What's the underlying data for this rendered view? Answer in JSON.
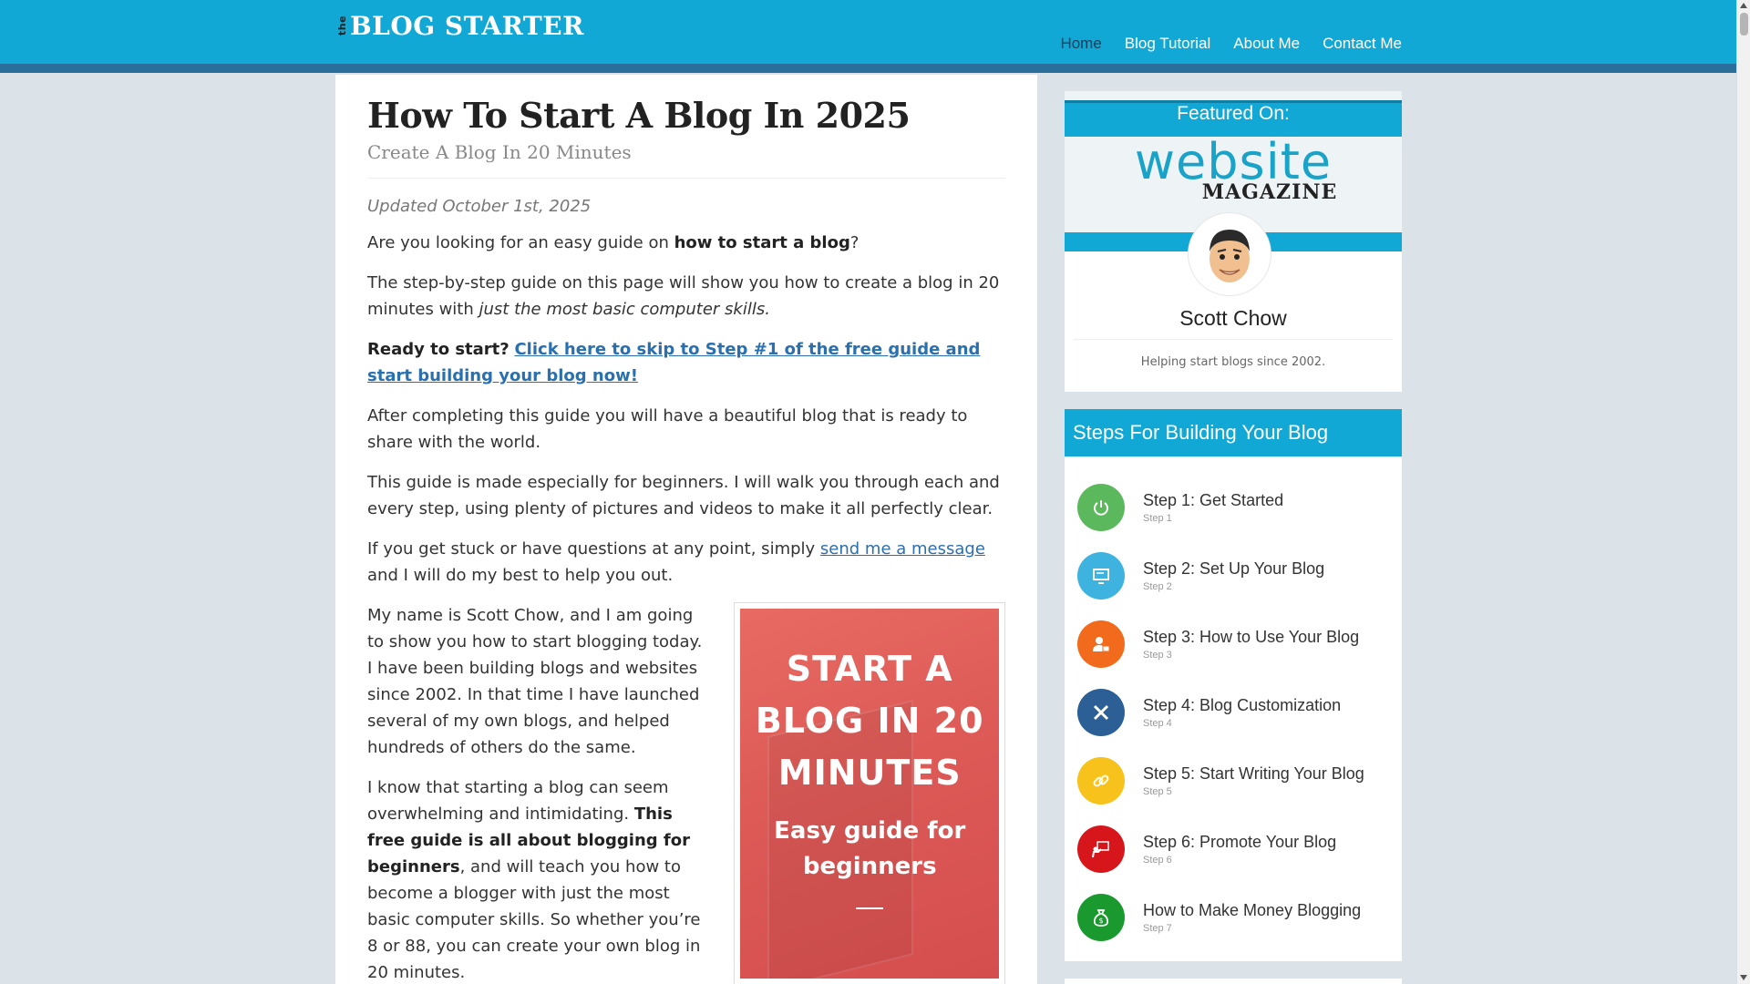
{
  "header": {
    "logo_the": "the",
    "logo_text": "BLOG STARTER",
    "nav": [
      {
        "label": "Home"
      },
      {
        "label": "Blog Tutorial"
      },
      {
        "label": "About Me"
      },
      {
        "label": "Contact Me"
      }
    ],
    "colors": {
      "bar": "#12a8d6",
      "strip": "#2a6f9b",
      "active_nav": "#1c3d55"
    }
  },
  "article": {
    "title": "How To Start A Blog In 2025",
    "subtitle": "Create A Blog In 20 Minutes",
    "updated": "Updated October 1st, 2025",
    "p1_pre": "Are you looking for an easy guide on ",
    "p1_bold": "how to start a blog",
    "p1_post": "?",
    "p2_pre": "The step-by-step guide on this page will show you how to create a blog in 20 minutes with ",
    "p2_italic": "just the most basic computer skills.",
    "p3_bold": "Ready to start?",
    "p3_link": "Click here to skip to Step #1 of the free guide and start building your blog now!",
    "p4": "After completing this guide you will have a beautiful blog that is ready to share with the world.",
    "p5": "This guide is made especially for beginners. I will walk you through each and every step, using plenty of pictures and videos to make it all perfectly clear.",
    "p6_pre": "If you get stuck or have questions at any point, simply ",
    "p6_link": "send me a message",
    "p6_post": " and I will do my best to help you out.",
    "p7": "My name is Scott Chow, and I am going to show you how to start blogging today. I have been building blogs and websites since 2002. In that time I have launched several of my own blogs, and helped hundreds of others do the same.",
    "p8_pre": "I know that starting a blog can seem overwhelming and intimidating. ",
    "p8_bold": "This free guide is all about blogging for beginners",
    "p8_post": ", and will teach you how to become a blogger with just the most basic computer skills. So whether you’re 8 or 88, you can create your own blog in 20 minutes.",
    "promo": {
      "title": "START A BLOG IN 20 MINUTES",
      "subtitle": "Easy guide for beginners"
    }
  },
  "sidebar": {
    "featured_label": "Featured On:",
    "logo_website": "website",
    "logo_magazine": "MAGAZINE",
    "author_name": "Scott Chow",
    "author_tagline": "Helping start blogs since 2002.",
    "steps_title": "Steps For Building Your Blog",
    "steps": [
      {
        "label": "Step 1: Get Started",
        "sub": "Step 1",
        "color": "#5cb85c",
        "icon": "power-icon"
      },
      {
        "label": "Step 2: Set Up Your Blog",
        "sub": "Step 2",
        "color": "#3fb3e0",
        "icon": "monitor-icon"
      },
      {
        "label": "Step 3: How to Use Your Blog",
        "sub": "Step 3",
        "color": "#f26b1d",
        "icon": "user-lock-icon"
      },
      {
        "label": "Step 4: Blog Customization",
        "sub": "Step 4",
        "color": "#2b5f95",
        "icon": "tools-icon"
      },
      {
        "label": "Step 5: Start Writing Your Blog",
        "sub": "Step 5",
        "color": "#f7c21b",
        "icon": "link-icon"
      },
      {
        "label": "Step 6: Promote Your Blog",
        "sub": "Step 6",
        "color": "#d7161b",
        "icon": "presentation-icon"
      },
      {
        "label": "How to Make Money Blogging",
        "sub": "Step 7",
        "color": "#1a9a2e",
        "icon": "money-bag-icon"
      }
    ]
  }
}
